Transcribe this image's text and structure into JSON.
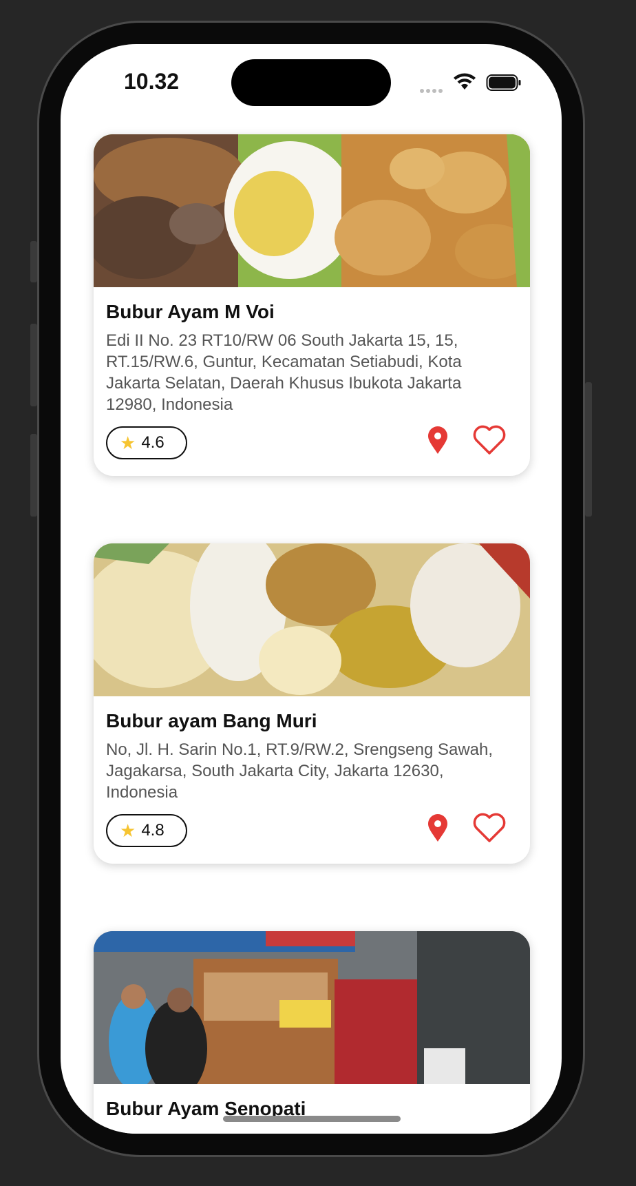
{
  "status": {
    "time": "10.32"
  },
  "colors": {
    "accent": "#e53935",
    "star": "#f6c431",
    "text": "#111111",
    "muted": "#555555"
  },
  "icons": {
    "location": "location-pin-icon",
    "favorite": "heart-outline-icon",
    "rating": "star-icon"
  },
  "restaurants": [
    {
      "name": "Bubur Ayam M Voi",
      "address": "Edi II No. 23 RT10/RW 06 South Jakarta 15, 15, RT.15/RW.6, Guntur, Kecamatan Setiabudi, Kota Jakarta Selatan, Daerah Khusus Ibukota Jakarta 12980, Indonesia",
      "rating": "4.6"
    },
    {
      "name": "Bubur ayam Bang Muri",
      "address": "No, Jl. H. Sarin No.1, RT.9/RW.2, Srengseng Sawah, Jagakarsa, South Jakarta City, Jakarta 12630, Indonesia",
      "rating": "4.8"
    },
    {
      "name": "Bubur Ayam Senopati"
    }
  ]
}
